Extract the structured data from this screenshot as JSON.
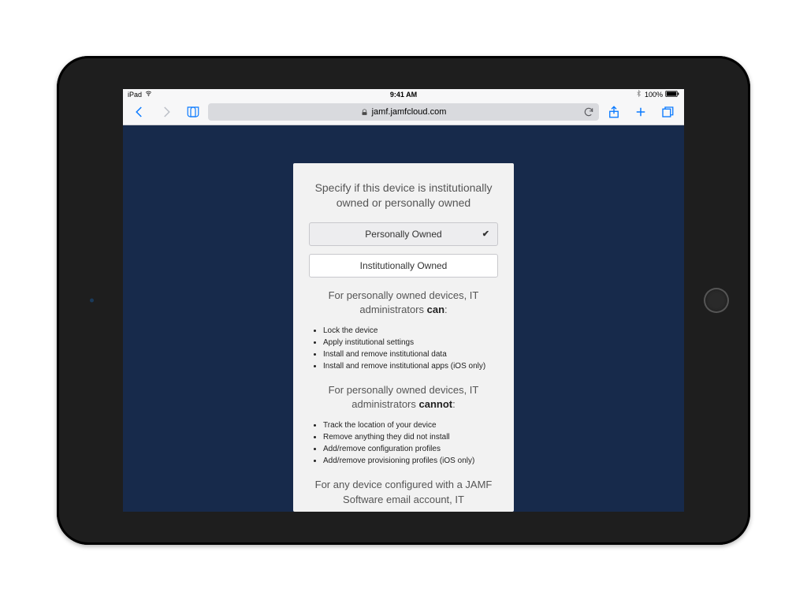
{
  "statusbar": {
    "carrier": "iPad",
    "time": "9:41 AM",
    "battery": "100%"
  },
  "toolbar": {
    "url": "jamf.jamfcloud.com"
  },
  "card": {
    "heading": "Specify if this device is institutionally owned or personally owned",
    "option_personal": "Personally Owned",
    "option_institutional": "Institutionally Owned",
    "can_heading_prefix": "For personally owned devices, IT administrators ",
    "can_heading_strong": "can",
    "can_heading_suffix": ":",
    "can_items": [
      "Lock the device",
      "Apply institutional settings",
      "Install and remove institutional data",
      "Install and remove institutional apps (iOS only)"
    ],
    "cannot_heading_prefix": "For personally owned devices, IT administrators ",
    "cannot_heading_strong": "cannot",
    "cannot_heading_suffix": ":",
    "cannot_items": [
      "Track the location of your device",
      "Remove anything they did not install",
      "Add/remove configuration profiles",
      "Add/remove provisioning profiles (iOS only)"
    ],
    "email_note": "For any device configured with a JAMF Software email account, IT"
  }
}
